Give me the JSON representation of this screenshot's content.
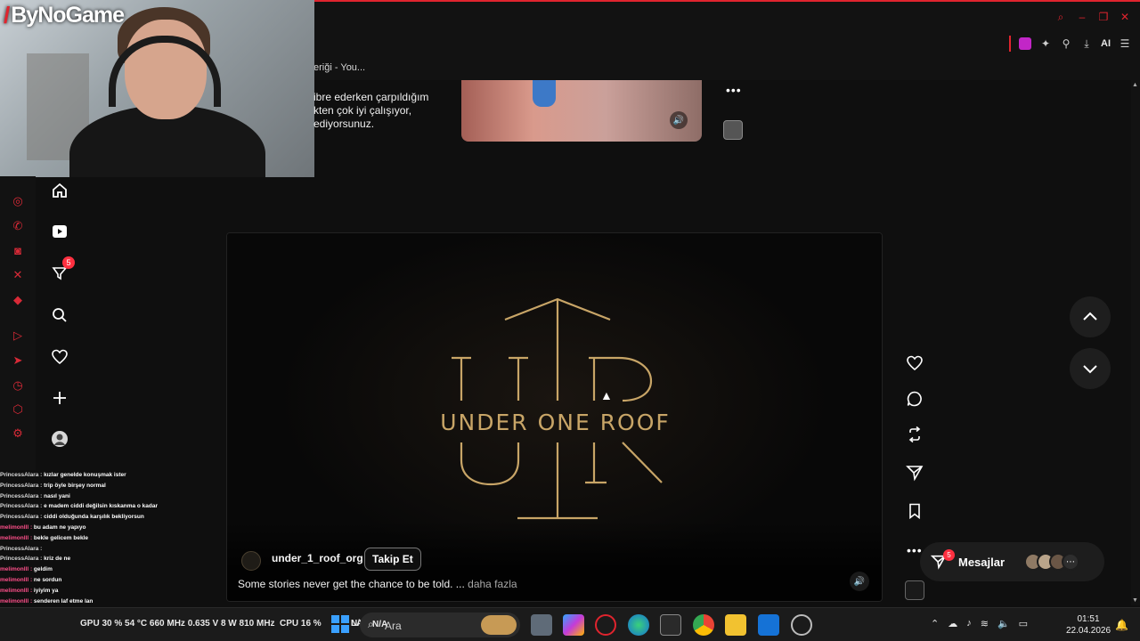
{
  "webcam": {
    "logo": "ByNoGame"
  },
  "browser": {
    "url_fragment": "/",
    "tab_fragment": "eriği - You...",
    "ai_label": "AI"
  },
  "top_post": {
    "text": "ibre ederken çarpıldığım\nkten çok iyi çalışıyor,\nediyorsunuz."
  },
  "left_nav": {
    "notifications_badge": "5"
  },
  "video": {
    "logo_text": "UNDER ONE ROOF",
    "author": "under_1_roof_org",
    "follow_label": "Takip Et",
    "caption": "Some stories never get the chance to be told. ...",
    "more_label": "daha fazla"
  },
  "messages": {
    "label": "Mesajlar",
    "badge": "5"
  },
  "chat": [
    {
      "user": "PrincessAlara",
      "text": "kızlar genelde konuşmak ister",
      "color": "#d9d9d9"
    },
    {
      "user": "PrincessAlara",
      "text": "trip öyle birşey normal",
      "color": "#d9d9d9"
    },
    {
      "user": "PrincessAlara",
      "text": "nasıl yani",
      "color": "#d9d9d9"
    },
    {
      "user": "PrincessAlara",
      "text": "e madem ciddi değilsin kıskanma o kadar",
      "color": "#d9d9d9"
    },
    {
      "user": "PrincessAlara",
      "text": "ciddi olduğunda karşılık bekliyorsun",
      "color": "#d9d9d9"
    },
    {
      "user": "melimonlll",
      "text": "bu adam ne yapıyo",
      "color": "#ff4f8a"
    },
    {
      "user": "melimonlll",
      "text": "bekle gelicem bekle",
      "color": "#ff4f8a"
    },
    {
      "user": "PrincessAlara",
      "text": "",
      "color": "#d9d9d9"
    },
    {
      "user": "PrincessAlara",
      "text": "kriz de ne",
      "color": "#d9d9d9"
    },
    {
      "user": "melimonlll",
      "text": "geldim",
      "color": "#ff4f8a"
    },
    {
      "user": "melimonlll",
      "text": "ne sordun",
      "color": "#ff4f8a"
    },
    {
      "user": "melimonlll",
      "text": "iyiyim ya",
      "color": "#ff4f8a"
    },
    {
      "user": "melimonlll",
      "text": "senderen laf etme lan",
      "color": "#ff4f8a"
    },
    {
      "user": "melimonlll",
      "text": "",
      "color": "#ff4f8a"
    }
  ],
  "taskbar": {
    "gpu": "GPU  30 %  54 °C  660 MHz  0.635 V  8 W  810 MHz",
    "cpu": "CPU  16 %",
    "lat": "LAT",
    "na1": "N/A",
    "na2": "N/A",
    "search_label": "Ara",
    "time": "01:51",
    "date": "22.04.2026"
  },
  "colors": {
    "accent": "#e0242e",
    "gold": "#c8a567",
    "badge": "#ff3040"
  }
}
